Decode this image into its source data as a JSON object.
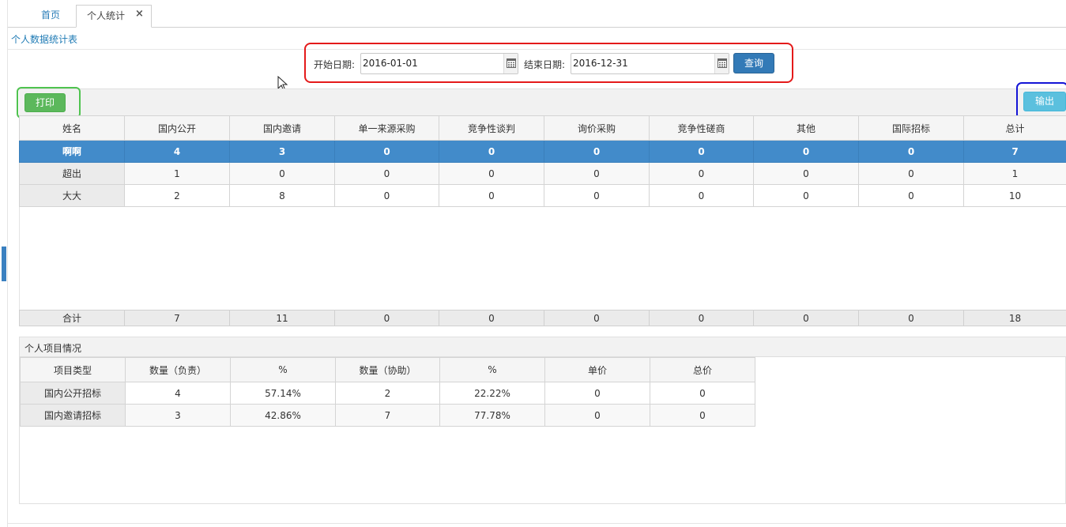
{
  "tabs": {
    "home": "首页",
    "active": "个人统计",
    "close_glyph": "×"
  },
  "page": {
    "title": "个人数据统计表"
  },
  "query": {
    "start_label": "开始日期:",
    "start_value": "2016-01-01",
    "end_label": "结束日期:",
    "end_value": "2016-12-31",
    "search_label": "查询"
  },
  "toolbar": {
    "print_label": "打印",
    "export_label": "输出"
  },
  "stats_table": {
    "headers": [
      "姓名",
      "国内公开",
      "国内邀请",
      "单一来源采购",
      "竞争性谈判",
      "询价采购",
      "竞争性磋商",
      "其他",
      "国际招标",
      "总计"
    ],
    "rows": [
      [
        "啊啊",
        "4",
        "3",
        "0",
        "0",
        "0",
        "0",
        "0",
        "0",
        "7"
      ],
      [
        "超出",
        "1",
        "0",
        "0",
        "0",
        "0",
        "0",
        "0",
        "0",
        "1"
      ],
      [
        "大大",
        "2",
        "8",
        "0",
        "0",
        "0",
        "0",
        "0",
        "0",
        "10"
      ]
    ],
    "footer": [
      "合计",
      "7",
      "11",
      "0",
      "0",
      "0",
      "0",
      "0",
      "0",
      "18"
    ]
  },
  "project_panel": {
    "title": "个人项目情况",
    "headers": [
      "项目类型",
      "数量（负责）",
      "%",
      "数量（协助）",
      "%",
      "单价",
      "总价"
    ],
    "rows": [
      [
        "国内公开招标",
        "4",
        "57.14%",
        "2",
        "22.22%",
        "0",
        "0"
      ],
      [
        "国内邀请招标",
        "3",
        "42.86%",
        "7",
        "77.78%",
        "0",
        "0"
      ]
    ]
  },
  "colors": {
    "accent": "#428bca",
    "query_highlight": "#e41a1a",
    "print_highlight": "#4fc34f",
    "export_highlight": "#1515d6"
  }
}
